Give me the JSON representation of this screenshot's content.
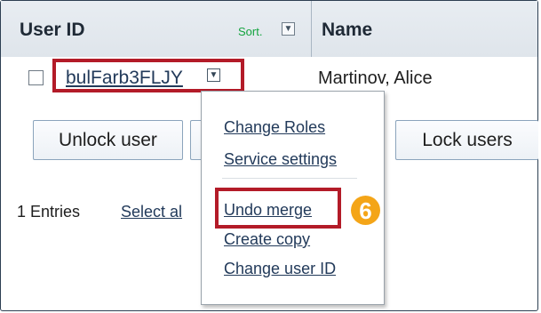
{
  "table": {
    "headers": {
      "user_id": "User ID",
      "sort": "Sort.",
      "name": "Name"
    },
    "rows": [
      {
        "user_id": "bulFarb3FLJY",
        "name": "Martinov, Alice"
      }
    ]
  },
  "toolbar": {
    "unlock_label": "Unlock user",
    "lock_label": "Lock users"
  },
  "footer": {
    "entries": "1 Entries",
    "select_all": "Select al"
  },
  "menu": {
    "items": [
      "Change Roles",
      "Service settings",
      "Undo merge",
      "Create copy",
      "Change user ID"
    ]
  },
  "step_badge": "6",
  "icons": {
    "sort": "chevron-down-icon",
    "row_menu": "dropdown-arrow-icon"
  },
  "colors": {
    "highlight": "#b31b28",
    "badge": "#f4a518",
    "sort_text": "#14a43f",
    "link": "#223a5a"
  }
}
